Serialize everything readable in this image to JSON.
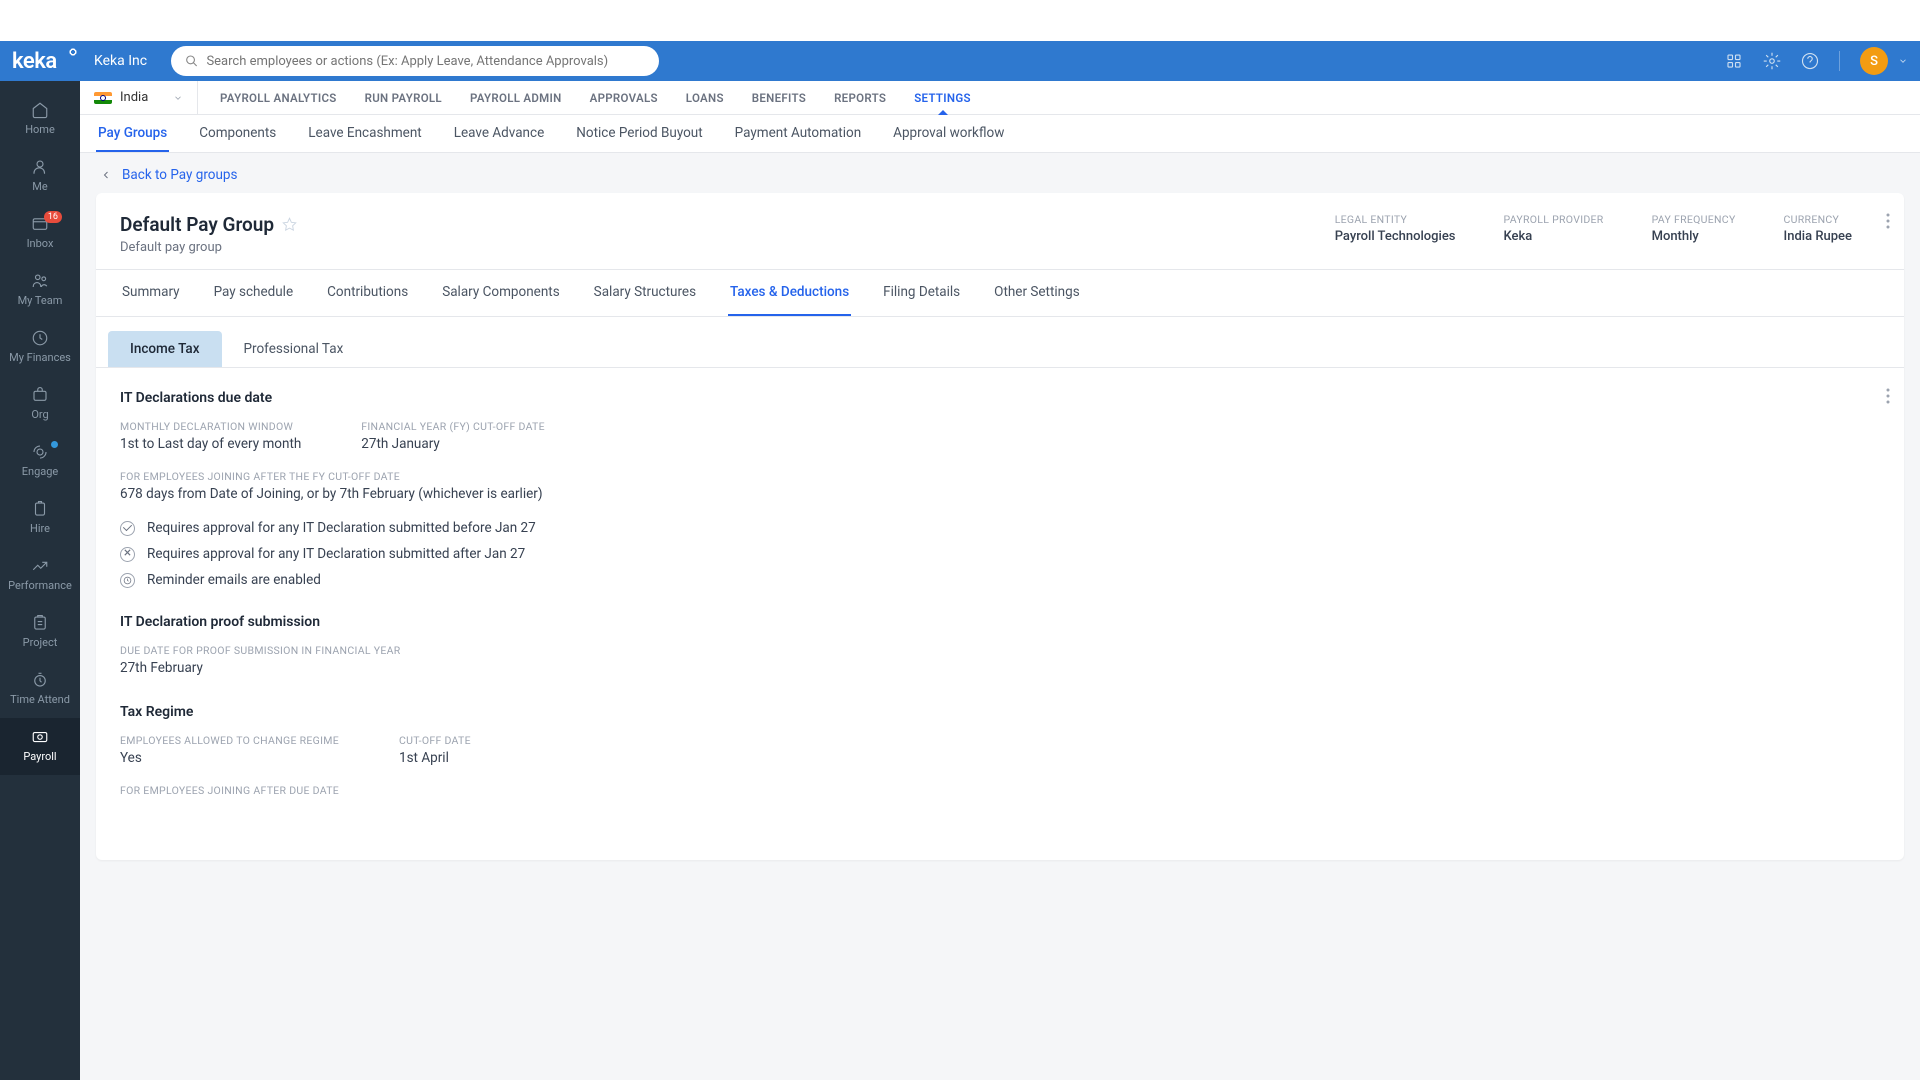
{
  "logo": "keka",
  "company": "Keka Inc",
  "search_placeholder": "Search employees or actions (Ex: Apply Leave, Attendance Approvals)",
  "avatar_letter": "S",
  "sidebar": [
    {
      "label": "Home"
    },
    {
      "label": "Me"
    },
    {
      "label": "Inbox",
      "badge": "16"
    },
    {
      "label": "My Team"
    },
    {
      "label": "My Finances"
    },
    {
      "label": "Org"
    },
    {
      "label": "Engage",
      "dot": true
    },
    {
      "label": "Hire"
    },
    {
      "label": "Performance"
    },
    {
      "label": "Project"
    },
    {
      "label": "Time Attend"
    },
    {
      "label": "Payroll",
      "active": true
    }
  ],
  "country": "India",
  "top_tabs": [
    "PAYROLL ANALYTICS",
    "RUN PAYROLL",
    "PAYROLL ADMIN",
    "APPROVALS",
    "LOANS",
    "BENEFITS",
    "REPORTS",
    "SETTINGS"
  ],
  "top_tab_active": 7,
  "sub_tabs": [
    "Pay Groups",
    "Components",
    "Leave Encashment",
    "Leave Advance",
    "Notice Period Buyout",
    "Payment Automation",
    "Approval workflow"
  ],
  "sub_tab_active": 0,
  "back_link": "Back to Pay groups",
  "paygroup": {
    "title": "Default Pay Group",
    "subtitle": "Default pay group",
    "meta": [
      {
        "label": "LEGAL ENTITY",
        "value": "Payroll Technologies"
      },
      {
        "label": "PAYROLL PROVIDER",
        "value": "Keka"
      },
      {
        "label": "PAY FREQUENCY",
        "value": "Monthly"
      },
      {
        "label": "CURRENCY",
        "value": "India Rupee"
      }
    ]
  },
  "inner_tabs": [
    "Summary",
    "Pay schedule",
    "Contributions",
    "Salary Components",
    "Salary Structures",
    "Taxes & Deductions",
    "Filing Details",
    "Other Settings"
  ],
  "inner_tab_active": 5,
  "tax_tabs": [
    "Income Tax",
    "Professional Tax"
  ],
  "tax_tab_active": 0,
  "sections": {
    "it_decl": {
      "title": "IT Declarations due date",
      "fields": [
        {
          "label": "MONTHLY DECLARATION WINDOW",
          "value": "1st to Last day of every month"
        },
        {
          "label": "FINANCIAL YEAR (FY) CUT-OFF DATE",
          "value": "27th January"
        }
      ],
      "joining": {
        "label": "FOR EMPLOYEES JOINING AFTER THE FY CUT-OFF DATE",
        "value": "678 days from Date of Joining, or by 7th February (whichever is earlier)"
      },
      "statuses": [
        {
          "icon": "check",
          "text": "Requires approval for any IT Declaration submitted before Jan 27"
        },
        {
          "icon": "x",
          "text": "Requires approval for any IT Declaration submitted after Jan 27"
        },
        {
          "icon": "clock",
          "text": "Reminder emails are enabled"
        }
      ]
    },
    "proof": {
      "title": "IT Declaration proof submission",
      "label": "DUE DATE FOR PROOF SUBMISSION IN FINANCIAL YEAR",
      "value": "27th February"
    },
    "regime": {
      "title": "Tax Regime",
      "fields": [
        {
          "label": "EMPLOYEES ALLOWED TO CHANGE REGIME",
          "value": "Yes"
        },
        {
          "label": "CUT-OFF DATE",
          "value": "1st April"
        }
      ],
      "after_label": "FOR EMPLOYEES JOINING AFTER DUE DATE"
    }
  }
}
